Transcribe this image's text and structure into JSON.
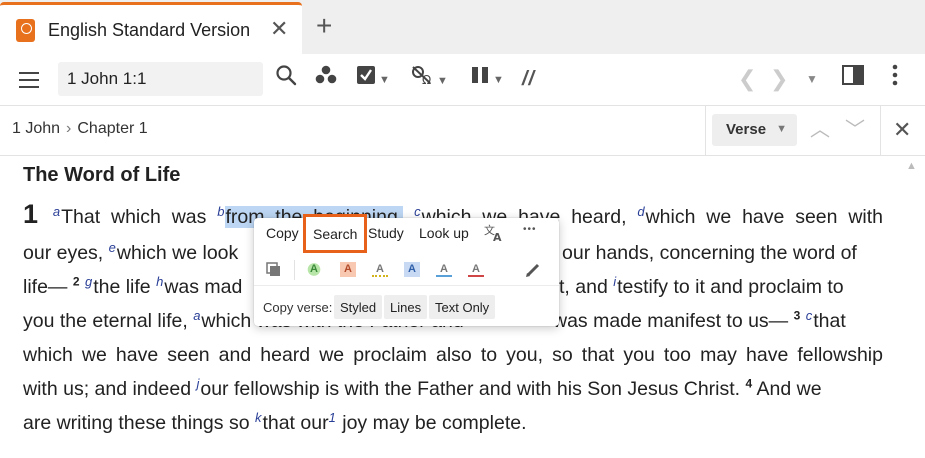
{
  "tab": {
    "title": "English Standard Version",
    "close": "✕",
    "add": "+"
  },
  "toolbar": {
    "reference": "1 John 1:1",
    "parallel_icon": "//"
  },
  "breadcrumb": {
    "book": "1 John",
    "separator": "›",
    "chapter": "Chapter 1"
  },
  "verse_select": {
    "label": "Verse"
  },
  "content": {
    "heading": "The Word of Life",
    "chapter_number": "1",
    "lines": {
      "l1": {
        "fa": "a",
        "t1": "That which was ",
        "fb": "b",
        "sel": "from the beginning,",
        "fc": "c",
        "t2": "which we have heard, ",
        "fd": "d",
        "t3": "which we have seen with"
      },
      "l2": {
        "t1": "our eyes, ",
        "fe": "e",
        "t2": "which we look",
        "t3": "our hands, concerning the word of"
      },
      "l3": {
        "t1": "life— ",
        "v2": "2",
        "fg": "g",
        "t2": "the life ",
        "fh": "h",
        "t3": "was mad",
        "t4": "t, and ",
        "fi": "i",
        "t5": "testify to it and proclaim to"
      },
      "l4": {
        "t1": "you the eternal life, ",
        "fa": "a",
        "t2": "which was with the Father and",
        "t3": "was made manifest to us— ",
        "v3": "3",
        "fc": "c",
        "t4": "that"
      },
      "l5": {
        "t1": "which we have seen and heard we proclaim also to you, so that you too may have fellowship"
      },
      "l6": {
        "t1": "with us; and indeed ",
        "fj": "j",
        "t2": "our fellowship is with the Father and with his Son Jesus Christ. ",
        "v4": "4",
        "t3": " And we"
      },
      "l7": {
        "t1": "are writing these things so ",
        "fk": "k",
        "t2": "that our",
        "f1": "1",
        "t3": " joy may be complete."
      }
    }
  },
  "popup": {
    "copy": "Copy",
    "search": "Search",
    "study": "Study",
    "lookup": "Look up",
    "more": "•••",
    "highlight_glyph": "A",
    "copy_verse_label": "Copy verse:",
    "styled": "Styled",
    "lines": "Lines",
    "text_only": "Text Only"
  },
  "colors": {
    "accent": "#e8711e",
    "search_outline": "#e8611a",
    "footnote": "#2a3f97",
    "selection": "#bcd6f3"
  }
}
